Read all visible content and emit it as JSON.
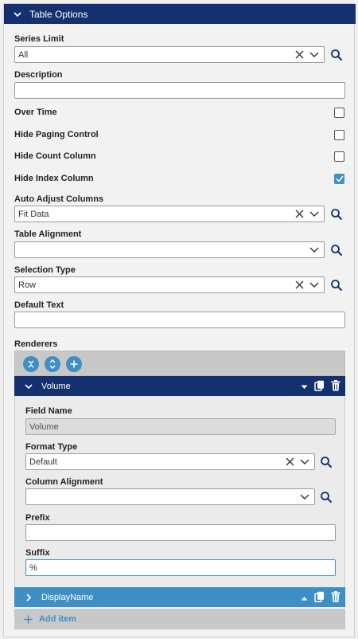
{
  "panel": {
    "title": "Table Options"
  },
  "series_limit": {
    "label": "Series Limit",
    "value": "All"
  },
  "description": {
    "label": "Description",
    "value": ""
  },
  "over_time": {
    "label": "Over Time",
    "checked": false
  },
  "hide_paging": {
    "label": "Hide Paging Control",
    "checked": false
  },
  "hide_count": {
    "label": "Hide Count Column",
    "checked": false
  },
  "hide_index": {
    "label": "Hide Index Column",
    "checked": true
  },
  "auto_adjust": {
    "label": "Auto Adjust Columns",
    "value": "Fit Data"
  },
  "table_alignment": {
    "label": "Table Alignment",
    "value": ""
  },
  "selection_type": {
    "label": "Selection Type",
    "value": "Row"
  },
  "default_text": {
    "label": "Default Text",
    "value": ""
  },
  "renderers": {
    "label": "Renderers",
    "items": [
      {
        "title": "Volume",
        "expanded": true,
        "field_name": {
          "label": "Field Name",
          "value": "Volume"
        },
        "format_type": {
          "label": "Format Type",
          "value": "Default"
        },
        "column_alignment": {
          "label": "Column Alignment",
          "value": ""
        },
        "prefix": {
          "label": "Prefix",
          "value": ""
        },
        "suffix": {
          "label": "Suffix",
          "value": "%"
        }
      },
      {
        "title": "DisplayName",
        "expanded": false
      }
    ],
    "add_label": "Add item"
  },
  "colors": {
    "header": "#14306e",
    "accent": "#3d8fc6",
    "collapsed_header": "#3d8fc6"
  }
}
